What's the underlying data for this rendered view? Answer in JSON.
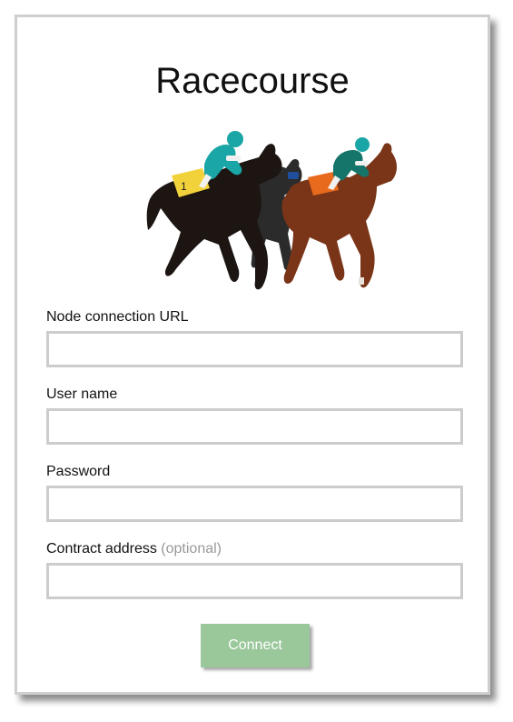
{
  "app": {
    "title": "Racecourse"
  },
  "hero_image": {
    "description_icon": "racehorses-image"
  },
  "form": {
    "node_url": {
      "label": "Node connection URL",
      "value": "",
      "placeholder": ""
    },
    "username": {
      "label": "User name",
      "value": "",
      "placeholder": ""
    },
    "password": {
      "label": "Password",
      "value": "",
      "placeholder": ""
    },
    "contract_address": {
      "label": "Contract address",
      "optional_note": "(optional)",
      "value": "",
      "placeholder": ""
    },
    "connect_label": "Connect"
  },
  "colors": {
    "button_bg": "#9bc89b",
    "border": "#cccccc",
    "optional_text": "#999999",
    "jockey_teal": "#1aa6a6"
  }
}
